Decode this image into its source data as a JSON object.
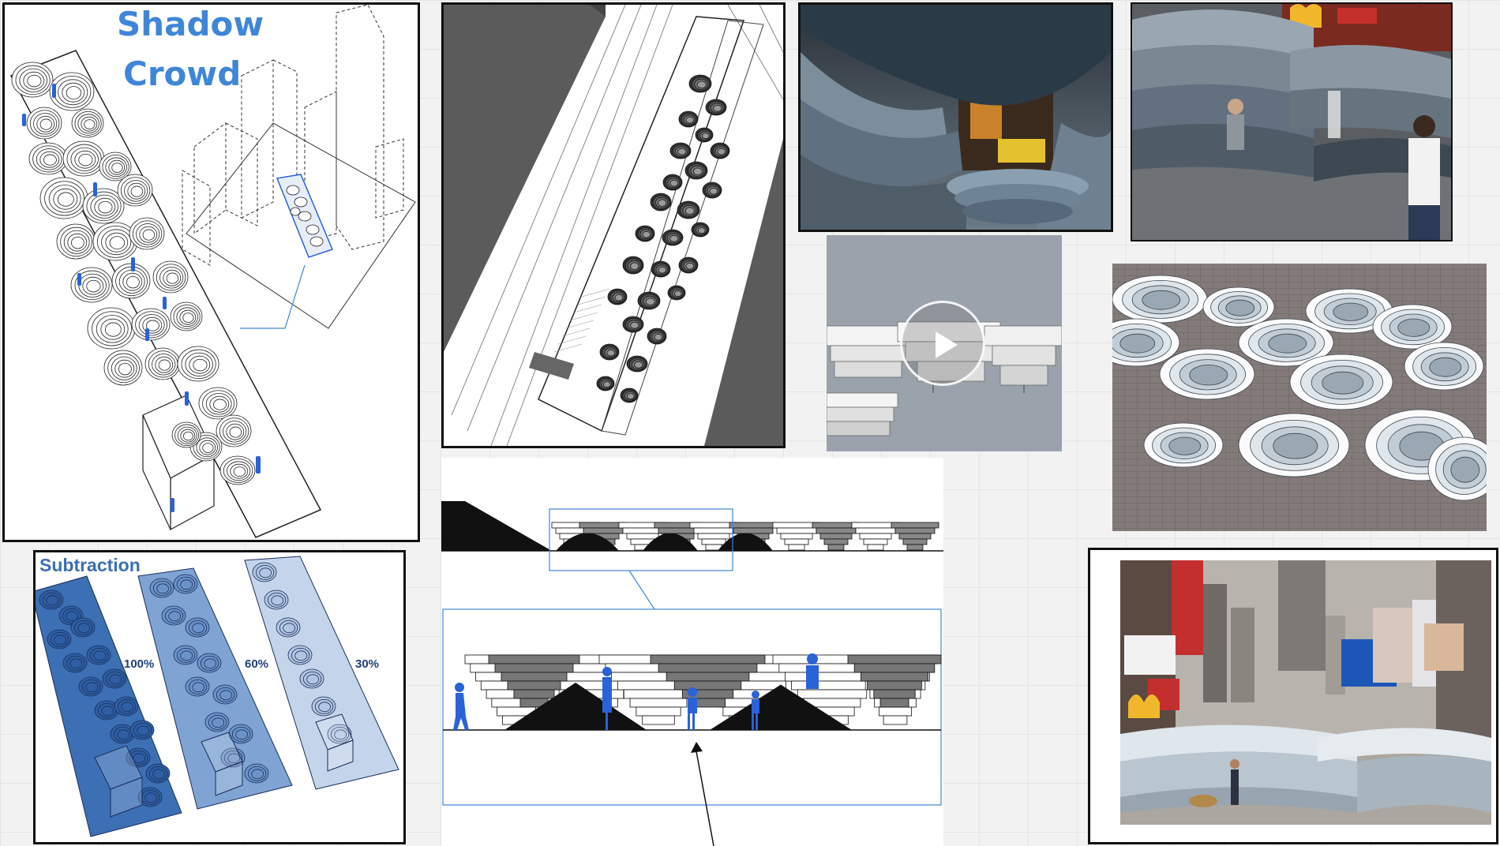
{
  "board": {
    "shadow_crowd": {
      "title_line1": "Shadow",
      "title_line2": "Crowd"
    },
    "subtraction": {
      "title": "Subtraction",
      "levels": [
        "100%",
        "60%",
        "30%"
      ]
    },
    "video_player": {
      "play_icon": "play-icon",
      "state": "paused"
    },
    "colors": {
      "accent_blue": "#3f86d8",
      "figure_blue": "#2a62d8",
      "panel_blue_dark": "#3d6fb5",
      "panel_blue_mid": "#7fa3d3",
      "panel_blue_light": "#c4d4ea",
      "render_gray": "#9aa3ab"
    }
  }
}
